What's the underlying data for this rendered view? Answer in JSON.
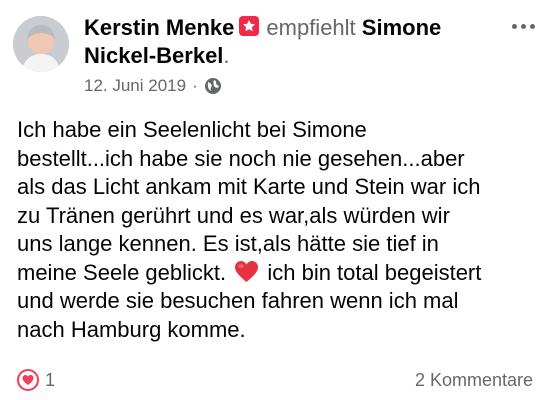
{
  "post": {
    "author": "Kerstin Menke",
    "action": "empfiehlt",
    "recommended_page": "Simone Nickel-Berkel",
    "trailing_dot": ".",
    "date": "12. Juni 2019",
    "separator": "·",
    "text_before_emoji": "Ich habe ein Seelenlicht bei Simone\nbestellt...ich habe sie noch nie gesehen...aber\nals das Licht ankam mit Karte und Stein war ich\nzu Tränen gerührt und es war,als würden wir\nuns lange kennen. Es ist,als hätte sie tief in\nmeine Seele geblickt. ",
    "text_after_emoji": " ich bin total begeistert\nund werde sie besuchen fahren wenn ich mal\nnach Hamburg komme."
  },
  "icons": {
    "recommend_badge": "recommend-flag-icon",
    "privacy": "globe-icon",
    "more": "more-options-icon",
    "emoji": "red-heart-emoji",
    "reaction": "love-reaction-icon"
  },
  "footer": {
    "reaction_count": "1",
    "comments": "2 Kommentare"
  },
  "colors": {
    "badge": "#f02849",
    "heart": "#e5323e",
    "secondary_text": "#65676b"
  }
}
